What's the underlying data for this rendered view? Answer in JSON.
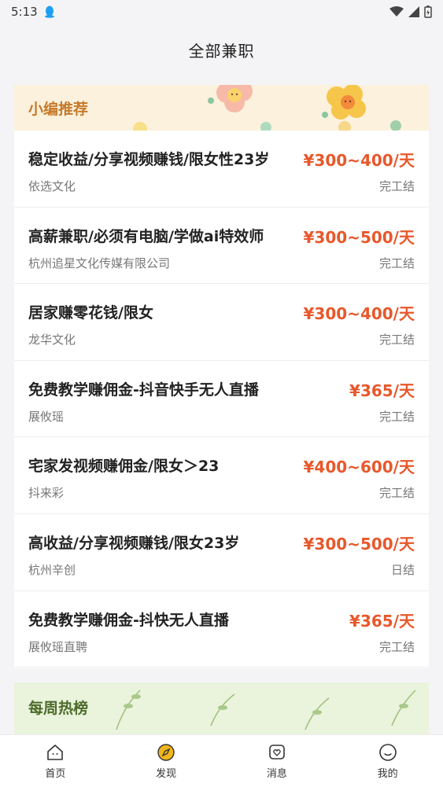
{
  "status_bar": {
    "time": "5:13",
    "notification_icon": "qq-penguin-icon"
  },
  "header": {
    "title": "全部兼职"
  },
  "recommend": {
    "title": "小编推荐",
    "jobs": [
      {
        "title": "稳定收益/分享视频赚钱/限女性23岁",
        "salary": "¥300~400/天",
        "company": "依选文化",
        "pay_type": "完工结"
      },
      {
        "title": "高薪兼职/必须有电脑/学做ai特效师",
        "salary": "¥300~500/天",
        "company": "杭州追星文化传媒有限公司",
        "pay_type": "完工结"
      },
      {
        "title": "居家赚零花钱/限女",
        "salary": "¥300~400/天",
        "company": "龙华文化",
        "pay_type": "完工结"
      },
      {
        "title": "免费教学赚佣金-抖音快手无人直播",
        "salary": "¥365/天",
        "company": "展攸瑶",
        "pay_type": "完工结"
      },
      {
        "title": "宅家发视频赚佣金/限女＞23",
        "salary": "¥400~600/天",
        "company": "抖来彩",
        "pay_type": "完工结"
      },
      {
        "title": "高收益/分享视频赚钱/限女23岁",
        "salary": "¥300~500/天",
        "company": "杭州辛创",
        "pay_type": "日结"
      },
      {
        "title": "免费教学赚佣金-抖快无人直播",
        "salary": "¥365/天",
        "company": "展攸瑶直聘",
        "pay_type": "完工结"
      }
    ]
  },
  "weekly": {
    "title": "每周热榜"
  },
  "nav": {
    "items": [
      {
        "label": "首页",
        "icon": "home-icon"
      },
      {
        "label": "发现",
        "icon": "compass-icon"
      },
      {
        "label": "消息",
        "icon": "message-heart-icon"
      },
      {
        "label": "我的",
        "icon": "smiley-profile-icon"
      }
    ]
  },
  "colors": {
    "accent": "#e8582b",
    "recommend_banner": "#fbf1dc",
    "recommend_title": "#c57a2c",
    "weekly_banner": "#eaf3dc",
    "discover_icon": "#f3b51c"
  }
}
